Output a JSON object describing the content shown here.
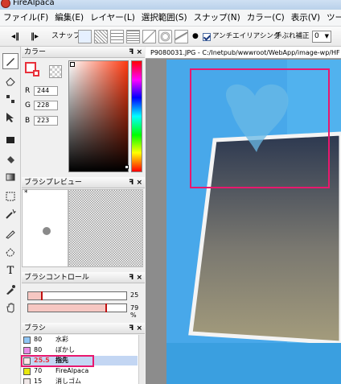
{
  "window": {
    "title": "FireAlpaca"
  },
  "menu": [
    "ファイル(F)",
    "編集(E)",
    "レイヤー(L)",
    "選択範囲(S)",
    "スナップ(N)",
    "カラー(C)",
    "表示(V)",
    "ツール("
  ],
  "toolbar": {
    "snap_label": "スナップ",
    "antialias_label": "アンチエイリアシング",
    "stabilizer_label": "手ぶれ補正",
    "stabilizer_value": "0"
  },
  "color_panel": {
    "title": "カラー",
    "r_label": "R",
    "r_value": "244",
    "g_label": "G",
    "g_value": "228",
    "b_label": "B",
    "b_value": "223",
    "fg_color": "#f4e4df",
    "accent": "#e8303a"
  },
  "brush_preview": {
    "title": "ブラシプレビュー",
    "marker": "*"
  },
  "brush_control": {
    "title": "ブラシコントロール",
    "size_value": "25",
    "size_fraction": 0.13,
    "opacity_value": "79 %",
    "opacity_fraction": 0.79
  },
  "brush_panel": {
    "title": "ブラシ",
    "items": [
      {
        "size": "80",
        "name": "水彩",
        "color": "#8ec5f5"
      },
      {
        "size": "80",
        "name": "ぼかし",
        "color": "#e98ae6"
      },
      {
        "size": "25.5",
        "name": "指先",
        "color": "#ffe6e8"
      },
      {
        "size": "70",
        "name": "FireAlpaca",
        "color": "#e8e80e"
      },
      {
        "size": "15",
        "name": "消しゴム",
        "color": "#f0e8e8"
      }
    ]
  },
  "panel_controls": "ꟻ ×",
  "document": {
    "tab": "P9080031.JPG - C:/Inetpub/wwwroot/WebApp/image-wp/HF"
  },
  "highlight_color": "#e8186e"
}
